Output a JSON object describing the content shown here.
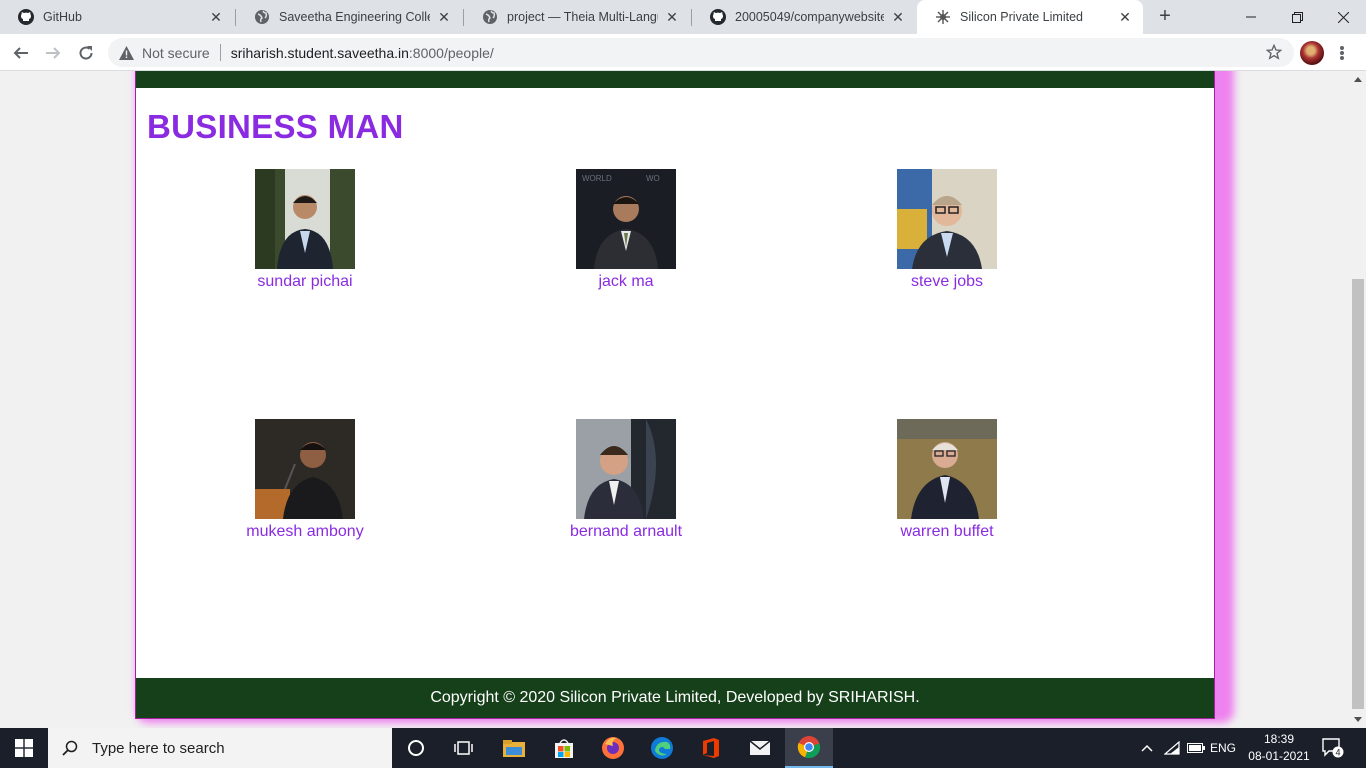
{
  "browser": {
    "tabs": [
      {
        "label": "GitHub",
        "icon": "github-icon"
      },
      {
        "label": "Saveetha Engineering College",
        "icon": "globe-icon"
      },
      {
        "label": "project — Theia Multi-Language",
        "icon": "globe-icon"
      },
      {
        "label": "20005049/companywebsite",
        "icon": "github-icon"
      },
      {
        "label": "Silicon Private Limited",
        "icon": "site-favicon-icon"
      }
    ],
    "active_tab": 4,
    "security_label": "Not secure",
    "url_host": "sriharish.student.saveetha.in",
    "url_path": ":8000/people/"
  },
  "page": {
    "heading": "BUSINESS MAN",
    "people": [
      {
        "name": "sundar pichai"
      },
      {
        "name": "jack ma"
      },
      {
        "name": "steve jobs"
      },
      {
        "name": "mukesh ambony"
      },
      {
        "name": "bernand arnault"
      },
      {
        "name": "warren buffet"
      }
    ],
    "footer": "Copyright © 2020 Silicon Private Limited, Developed by SRIHARISH."
  },
  "taskbar": {
    "search_placeholder": "Type here to search",
    "language": "ENG",
    "time": "18:39",
    "date": "08-01-2021",
    "notification_count": "4"
  },
  "colors": {
    "accent": "#8a2be2",
    "header_footer": "#16401a",
    "page_glow": "#ee82ee"
  }
}
